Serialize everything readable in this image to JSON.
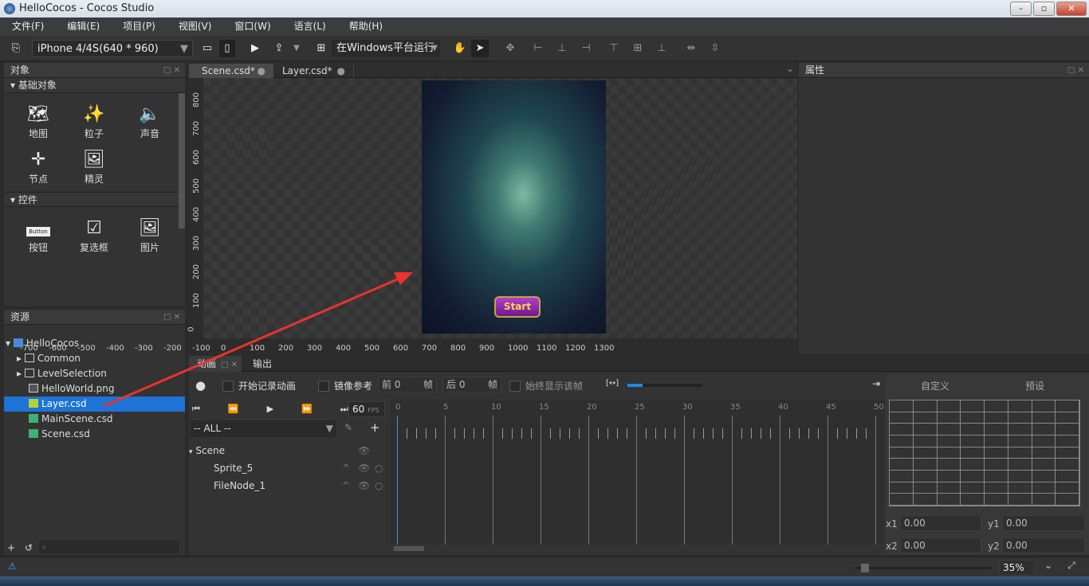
{
  "window": {
    "title": "HelloCocos - Cocos Studio"
  },
  "menu": [
    "文件(F)",
    "编辑(E)",
    "项目(P)",
    "视图(V)",
    "窗口(W)",
    "语言(L)",
    "帮助(H)"
  ],
  "toolbar": {
    "device": "iPhone 4/4S(640 * 960)",
    "run_target": "在Windows平台运行"
  },
  "objects_panel": {
    "title": "对象",
    "basic_section": "基础对象",
    "basic_items": [
      {
        "label": "地图",
        "icon": "map-icon"
      },
      {
        "label": "粒子",
        "icon": "particle-icon"
      },
      {
        "label": "声音",
        "icon": "sound-icon"
      },
      {
        "label": "节点",
        "icon": "node-icon"
      },
      {
        "label": "精灵",
        "icon": "sprite-icon"
      }
    ],
    "controls_section": "控件",
    "control_items": [
      {
        "label": "按钮",
        "icon": "button-icon",
        "icon_text": "Button"
      },
      {
        "label": "复选框",
        "icon": "checkbox-icon"
      },
      {
        "label": "图片",
        "icon": "image-icon"
      }
    ]
  },
  "resources_panel": {
    "title": "资源",
    "root": "HelloCocos",
    "items": [
      {
        "label": "Common",
        "type": "folder"
      },
      {
        "label": "LevelSelection",
        "type": "folder"
      },
      {
        "label": "HelloWorld.png",
        "type": "image"
      },
      {
        "label": "Layer.csd",
        "type": "csd",
        "selected": true
      },
      {
        "label": "MainScene.csd",
        "type": "csd"
      },
      {
        "label": "Scene.csd",
        "type": "csd"
      }
    ]
  },
  "editor": {
    "tabs": [
      {
        "label": "Scene.csd*",
        "active": true
      },
      {
        "label": "Layer.csd*",
        "active": false
      }
    ],
    "ruler_x": [
      "-700",
      "-600",
      "-500",
      "-400",
      "-300",
      "-200",
      "-100",
      "0",
      "100",
      "200",
      "300",
      "400",
      "500",
      "600",
      "700",
      "800",
      "900",
      "1000",
      "1100",
      "1200",
      "1300"
    ],
    "ruler_y": [
      "0",
      "100",
      "200",
      "300",
      "400",
      "500",
      "600",
      "700",
      "800"
    ],
    "start_button": "Start"
  },
  "properties_panel": {
    "title": "属性"
  },
  "animation_panel": {
    "tabs": [
      "动画",
      "输出"
    ],
    "record": "开始记录动画",
    "onion": "镜像参考",
    "before_label": "前",
    "before_value": "0",
    "before_unit": "帧",
    "after_label": "后",
    "after_value": "0",
    "after_unit": "帧",
    "always_show": "始终显示该帧",
    "fps": "60",
    "fps_unit": "FPS",
    "filter": "-- ALL --",
    "tree": [
      "Scene",
      "Sprite_5",
      "FileNode_1"
    ],
    "frames": [
      "0",
      "5",
      "10",
      "15",
      "20",
      "25",
      "30",
      "35",
      "40",
      "45",
      "50"
    ],
    "easing_tabs": [
      "自定义",
      "预设"
    ],
    "x1": "0.00",
    "y1": "0.00",
    "x2": "0.00",
    "y2": "0.00",
    "x1_label": "x1",
    "y1_label": "y1",
    "x2_label": "x2",
    "y2_label": "y2",
    "zoom_fraction": 0.2
  },
  "status": {
    "zoom": "35%"
  },
  "colors": {
    "accent": "#1e88e5",
    "selection": "#1e73d6",
    "arrow": "#e8332f"
  }
}
